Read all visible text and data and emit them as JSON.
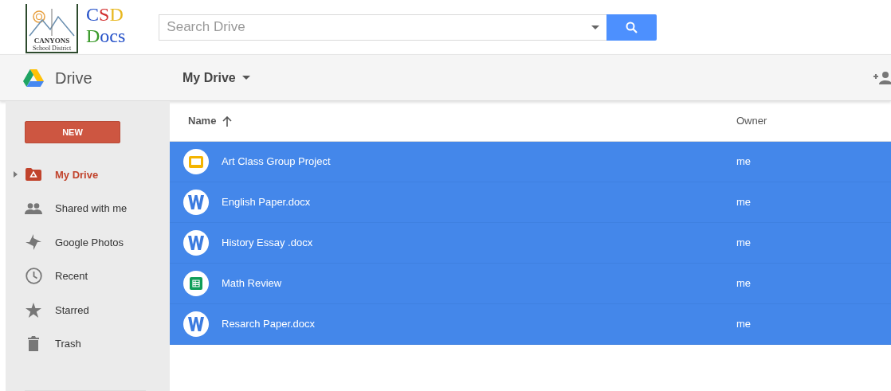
{
  "logo": {
    "title": "CSD",
    "subtitle": "Docs",
    "district": "CANYONS",
    "district_subtitle": "School District"
  },
  "search": {
    "placeholder": "Search Drive"
  },
  "app": {
    "title": "Drive"
  },
  "breadcrumb": {
    "label": "My Drive"
  },
  "new_button": {
    "label": "NEW"
  },
  "sidebar": {
    "items": [
      {
        "label": "My Drive",
        "kind": "drive",
        "selected": true,
        "expandable": true
      },
      {
        "label": "Shared with me",
        "kind": "shared",
        "selected": false
      },
      {
        "label": "Google Photos",
        "kind": "photos",
        "selected": false
      },
      {
        "label": "Recent",
        "kind": "recent",
        "selected": false
      },
      {
        "label": "Starred",
        "kind": "starred",
        "selected": false
      },
      {
        "label": "Trash",
        "kind": "trash",
        "selected": false
      }
    ]
  },
  "table": {
    "columns": [
      {
        "label": "Name",
        "sorted_ascending": true
      },
      {
        "label": "Owner"
      }
    ],
    "rows": [
      {
        "name": "Art Class Group Project",
        "kind": "slides",
        "owner": "me",
        "selected": true
      },
      {
        "name": "English Paper.docx",
        "kind": "word",
        "owner": "me",
        "selected": true
      },
      {
        "name": "History Essay .docx",
        "kind": "word",
        "owner": "me",
        "selected": true
      },
      {
        "name": "Math Review",
        "kind": "sheet",
        "owner": "me",
        "selected": true
      },
      {
        "name": "Resarch Paper.docx",
        "kind": "word",
        "owner": "me",
        "selected": true
      }
    ]
  }
}
